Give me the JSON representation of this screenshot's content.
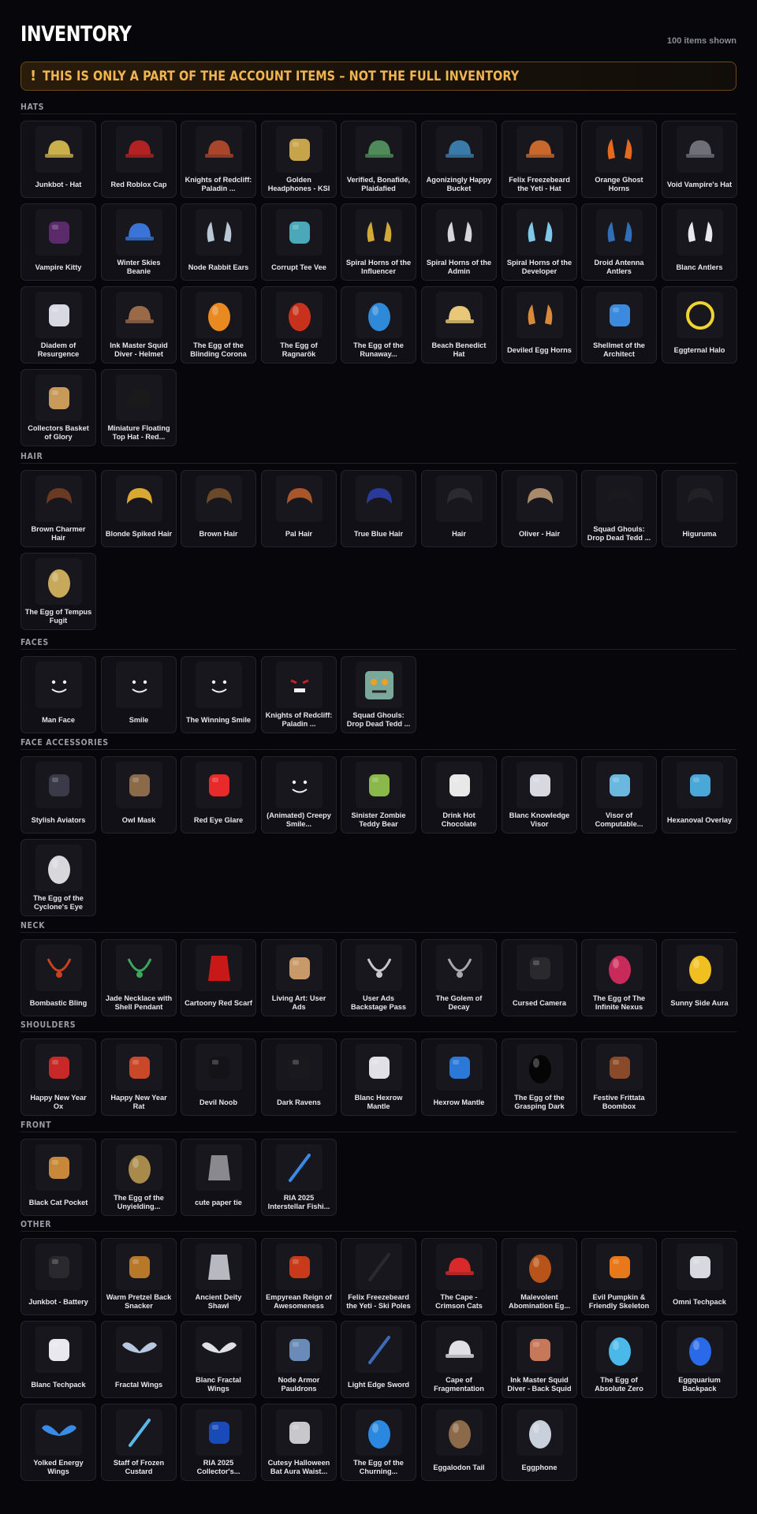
{
  "header": {
    "title": "INVENTORY",
    "count_label": "100 items shown"
  },
  "banner": {
    "icon": "!",
    "text": "THIS IS ONLY A PART OF THE ACCOUNT ITEMS – NOT THE FULL INVENTORY"
  },
  "colors": {
    "background": "#07070b",
    "card": "#101016",
    "banner_accent": "#f0b550"
  },
  "sections": [
    {
      "title": "HATS",
      "items": [
        {
          "name": "Junkbot - Hat",
          "icon": "junkbot-hat-icon",
          "color": "#c9b04a"
        },
        {
          "name": "Red Roblox Cap",
          "icon": "red-cap-icon",
          "color": "#b22222"
        },
        {
          "name": "Knights of Redcliff: Paladin ...",
          "icon": "paladin-helmet-icon",
          "color": "#a8452a"
        },
        {
          "name": "Golden Headphones - KSI",
          "icon": "headphones-icon",
          "color": "#c7a34a"
        },
        {
          "name": "Verified, Bonafide, Plaidafied",
          "icon": "plaid-cap-icon",
          "color": "#4f8a5a"
        },
        {
          "name": "Agonizingly Happy Bucket",
          "icon": "bucket-icon",
          "color": "#3a7aa8"
        },
        {
          "name": "Felix Freezebeard the Yeti - Hat",
          "icon": "yeti-hat-icon",
          "color": "#c8682c"
        },
        {
          "name": "Orange Ghost Horns",
          "icon": "orange-horns-icon",
          "color": "#e56a1f"
        },
        {
          "name": "Void Vampire's Hat",
          "icon": "vampire-hat-icon",
          "color": "#6f6f78"
        },
        {
          "name": "Vampire Kitty",
          "icon": "vampire-kitty-icon",
          "color": "#5a2a6a"
        },
        {
          "name": "Winter Skies Beanie",
          "icon": "beanie-icon",
          "color": "#3a74d6"
        },
        {
          "name": "Node Rabbit Ears",
          "icon": "rabbit-ears-icon",
          "color": "#b9c7d6"
        },
        {
          "name": "Corrupt Tee Vee",
          "icon": "tv-head-icon",
          "color": "#4aa8b8"
        },
        {
          "name": "Spiral Horns of the Influencer",
          "icon": "gold-spiral-horns-icon",
          "color": "#d2a936"
        },
        {
          "name": "Spiral Horns of the Admin",
          "icon": "silver-spiral-horns-icon",
          "color": "#d5d5dc"
        },
        {
          "name": "Spiral Horns of the Developer",
          "icon": "blue-spiral-horns-icon",
          "color": "#7ec8e8"
        },
        {
          "name": "Droid Antenna Antlers",
          "icon": "droid-antlers-icon",
          "color": "#2f6fb8"
        },
        {
          "name": "Blanc Antlers",
          "icon": "white-antlers-icon",
          "color": "#e8e8ee"
        },
        {
          "name": "Diadem of Resurgence",
          "icon": "diadem-icon",
          "color": "#d8d8e2"
        },
        {
          "name": "Ink Master Squid Diver - Helmet",
          "icon": "diver-helmet-icon",
          "color": "#9a6a48"
        },
        {
          "name": "The Egg of the Blinding Corona",
          "icon": "corona-egg-icon",
          "color": "#e88a1f"
        },
        {
          "name": "The Egg of Ragnarök",
          "icon": "ragnarok-egg-icon",
          "color": "#c8321c"
        },
        {
          "name": "The Egg of the Runaway...",
          "icon": "runaway-egg-icon",
          "color": "#2e8ad8"
        },
        {
          "name": "Beach Benedict Hat",
          "icon": "benedict-hat-icon",
          "color": "#e8c878"
        },
        {
          "name": "Deviled Egg Horns",
          "icon": "deviled-horns-icon",
          "color": "#d88a3a"
        },
        {
          "name": "Shellmet of the Architect",
          "icon": "shellmet-icon",
          "color": "#3a8ae0"
        },
        {
          "name": "Eggternal Halo",
          "icon": "halo-icon",
          "color": "#f0d232"
        },
        {
          "name": "Collectors Basket of Glory",
          "icon": "basket-icon",
          "color": "#c89a5a"
        },
        {
          "name": "Miniature Floating Top Hat - Red...",
          "icon": "top-hat-icon",
          "color": "#1a1a1a"
        }
      ]
    },
    {
      "title": "HAIR",
      "items": [
        {
          "name": "Brown Charmer Hair",
          "icon": "brown-hair-icon",
          "color": "#6a3a22"
        },
        {
          "name": "Blonde Spiked Hair",
          "icon": "blonde-hair-icon",
          "color": "#d8a832"
        },
        {
          "name": "Brown Hair",
          "icon": "brown-hair-icon",
          "color": "#6a4828"
        },
        {
          "name": "Pal Hair",
          "icon": "pal-hair-icon",
          "color": "#a8562a"
        },
        {
          "name": "True Blue Hair",
          "icon": "blue-hair-icon",
          "color": "#2a3a9a"
        },
        {
          "name": "Hair",
          "icon": "black-hair-icon",
          "color": "#2a2a30"
        },
        {
          "name": "Oliver - Hair",
          "icon": "oliver-hair-icon",
          "color": "#a88a6a"
        },
        {
          "name": "Squad Ghouls: Drop Dead Tedd ...",
          "icon": "ghoul-hair-icon",
          "color": "#1a1a1e"
        },
        {
          "name": "Higuruma",
          "icon": "higuruma-hair-icon",
          "color": "#222226"
        },
        {
          "name": "The Egg of Tempus Fugit",
          "icon": "tempus-egg-icon",
          "color": "#c8a85a"
        }
      ]
    },
    {
      "title": "FACES",
      "items": [
        {
          "name": "Man Face",
          "icon": "man-face-icon",
          "color": "#111111"
        },
        {
          "name": "Smile",
          "icon": "smile-face-icon",
          "color": "#111111"
        },
        {
          "name": "The Winning Smile",
          "icon": "winning-smile-icon",
          "color": "#111111"
        },
        {
          "name": "Knights of Redcliff: Paladin ...",
          "icon": "paladin-face-icon",
          "color": "#c82020"
        },
        {
          "name": "Squad Ghouls: Drop Dead Tedd ...",
          "icon": "ghoul-face-icon",
          "color": "#7aa89a"
        }
      ]
    },
    {
      "title": "FACE ACCESSORIES",
      "items": [
        {
          "name": "Stylish Aviators",
          "icon": "aviators-icon",
          "color": "#3a3a48"
        },
        {
          "name": "Owl Mask",
          "icon": "owl-mask-icon",
          "color": "#8a6a48"
        },
        {
          "name": "Red Eye Glare",
          "icon": "eye-glare-icon",
          "color": "#e82a2a"
        },
        {
          "name": "(Animated) Creepy Smile...",
          "icon": "creepy-smile-icon",
          "color": "#e81818"
        },
        {
          "name": "Sinister Zombie Teddy Bear",
          "icon": "teddy-bear-icon",
          "color": "#8ab84a"
        },
        {
          "name": "Drink Hot Chocolate",
          "icon": "hot-chocolate-icon",
          "color": "#e8e8e8"
        },
        {
          "name": "Blanc Knowledge Visor",
          "icon": "knowledge-visor-icon",
          "color": "#d8d8e0"
        },
        {
          "name": "Visor of Computable...",
          "icon": "computable-visor-icon",
          "color": "#6ab8e0"
        },
        {
          "name": "Hexanoval Overlay",
          "icon": "hex-overlay-icon",
          "color": "#4aa8d8"
        },
        {
          "name": "The Egg of the Cyclone's Eye",
          "icon": "cyclone-egg-icon",
          "color": "#d8d8dc"
        }
      ]
    },
    {
      "title": "NECK",
      "items": [
        {
          "name": "Bombastic Bling",
          "icon": "bling-icon",
          "color": "#c8421c"
        },
        {
          "name": "Jade Necklace with Shell Pendant",
          "icon": "jade-necklace-icon",
          "color": "#3aa85a"
        },
        {
          "name": "Cartoony Red Scarf",
          "icon": "red-scarf-icon",
          "color": "#c81818"
        },
        {
          "name": "Living Art: User Ads",
          "icon": "user-ads-icon",
          "color": "#c89a6a"
        },
        {
          "name": "User Ads Backstage Pass",
          "icon": "backstage-pass-icon",
          "color": "#c8c8cc"
        },
        {
          "name": "The Golem of Decay",
          "icon": "golem-necklace-icon",
          "color": "#a8a8ac"
        },
        {
          "name": "Cursed Camera",
          "icon": "camera-icon",
          "color": "#2a2a2e"
        },
        {
          "name": "The Egg of The Infinite Nexus",
          "icon": "nexus-egg-icon",
          "color": "#c82a5a"
        },
        {
          "name": "Sunny Side Aura",
          "icon": "fried-egg-icon",
          "color": "#f0c020"
        }
      ]
    },
    {
      "title": "SHOULDERS",
      "items": [
        {
          "name": "Happy New Year Ox",
          "icon": "ox-icon",
          "color": "#c82828"
        },
        {
          "name": "Happy New Year Rat",
          "icon": "rat-icon",
          "color": "#c84828"
        },
        {
          "name": "Devil Noob",
          "icon": "devil-noob-icon",
          "color": "#141418"
        },
        {
          "name": "Dark Ravens",
          "icon": "raven-icon",
          "color": "#1a1a1e"
        },
        {
          "name": "Blanc Hexrow Mantle",
          "icon": "white-hex-mantle-icon",
          "color": "#e0e0e6"
        },
        {
          "name": "Hexrow Mantle",
          "icon": "blue-hex-mantle-icon",
          "color": "#2a78d8"
        },
        {
          "name": "The Egg of the Grasping Dark",
          "icon": "dark-egg-icon",
          "color": "#050505"
        },
        {
          "name": "Festive Frittata Boombox",
          "icon": "boombox-icon",
          "color": "#8a4a2a"
        }
      ]
    },
    {
      "title": "FRONT",
      "items": [
        {
          "name": "Black Cat Pocket",
          "icon": "cat-pocket-icon",
          "color": "#c8883a"
        },
        {
          "name": "The Egg of the Unyielding...",
          "icon": "unyielding-egg-icon",
          "color": "#a88a4a"
        },
        {
          "name": "cute paper tie",
          "icon": "paper-tie-icon",
          "color": "#8a8a8e"
        },
        {
          "name": "RIA 2025 Interstellar Fishi...",
          "icon": "fishing-rod-icon",
          "color": "#3a8ae8"
        }
      ]
    },
    {
      "title": "OTHER",
      "items": [
        {
          "name": "Junkbot - Battery",
          "icon": "battery-icon",
          "color": "#2a2a2e"
        },
        {
          "name": "Warm Pretzel Back Snacker",
          "icon": "pretzel-icon",
          "color": "#b8782a"
        },
        {
          "name": "Ancient Deity Shawl",
          "icon": "shawl-icon",
          "color": "#b8b8c0"
        },
        {
          "name": "Empyrean Reign of Awesomeness",
          "icon": "empyrean-icon",
          "color": "#c83a1a"
        },
        {
          "name": "Felix Freezebeard the Yeti - Ski Poles",
          "icon": "ski-poles-icon",
          "color": "#2a2a2e"
        },
        {
          "name": "The Cape - Crimson Cats",
          "icon": "crimson-cape-icon",
          "color": "#d82a2a"
        },
        {
          "name": "Malevolent Abomination Eg...",
          "icon": "abomination-egg-icon",
          "color": "#b8541a"
        },
        {
          "name": "Evil Pumpkin & Friendly Skeleton",
          "icon": "pumpkin-skeleton-icon",
          "color": "#e8781a"
        },
        {
          "name": "Omni Techpack",
          "icon": "omni-techpack-icon",
          "color": "#d8d8e0"
        },
        {
          "name": "Blanc Techpack",
          "icon": "blanc-techpack-icon",
          "color": "#e8e8ee"
        },
        {
          "name": "Fractal Wings",
          "icon": "fractal-wings-icon",
          "color": "#b8c8e0"
        },
        {
          "name": "Blanc Fractal Wings",
          "icon": "blanc-wings-icon",
          "color": "#e0e0e8"
        },
        {
          "name": "Node Armor Pauldrons",
          "icon": "pauldrons-icon",
          "color": "#6a8ab8"
        },
        {
          "name": "Light Edge Sword",
          "icon": "sword-icon",
          "color": "#3a6ab8"
        },
        {
          "name": "Cape of Fragmentation",
          "icon": "fragment-cape-icon",
          "color": "#e0e0e4"
        },
        {
          "name": "Ink Master Squid Diver - Back Squid",
          "icon": "squid-icon",
          "color": "#c8785a"
        },
        {
          "name": "The Egg of Absolute Zero",
          "icon": "absolute-zero-egg-icon",
          "color": "#4ab8e8"
        },
        {
          "name": "Eggquarium Backpack",
          "icon": "eggquarium-icon",
          "color": "#2a6ae8"
        },
        {
          "name": "Yolked Energy Wings",
          "icon": "energy-wings-icon",
          "color": "#3a8ae8"
        },
        {
          "name": "Staff of Frozen Custard",
          "icon": "staff-icon",
          "color": "#5ab8e8"
        },
        {
          "name": "RIA 2025 Collector's...",
          "icon": "collector-card-icon",
          "color": "#1a4ab8"
        },
        {
          "name": "Cutesy Halloween Bat Aura Waist...",
          "icon": "bat-aura-icon",
          "color": "#c8c8cc"
        },
        {
          "name": "The Egg of the Churning...",
          "icon": "churning-egg-icon",
          "color": "#2a88e0"
        },
        {
          "name": "Eggalodon Tail",
          "icon": "eggalodon-tail-icon",
          "color": "#8a6a48"
        },
        {
          "name": "Eggphone",
          "icon": "eggphone-icon",
          "color": "#c8d0dc"
        }
      ]
    }
  ]
}
